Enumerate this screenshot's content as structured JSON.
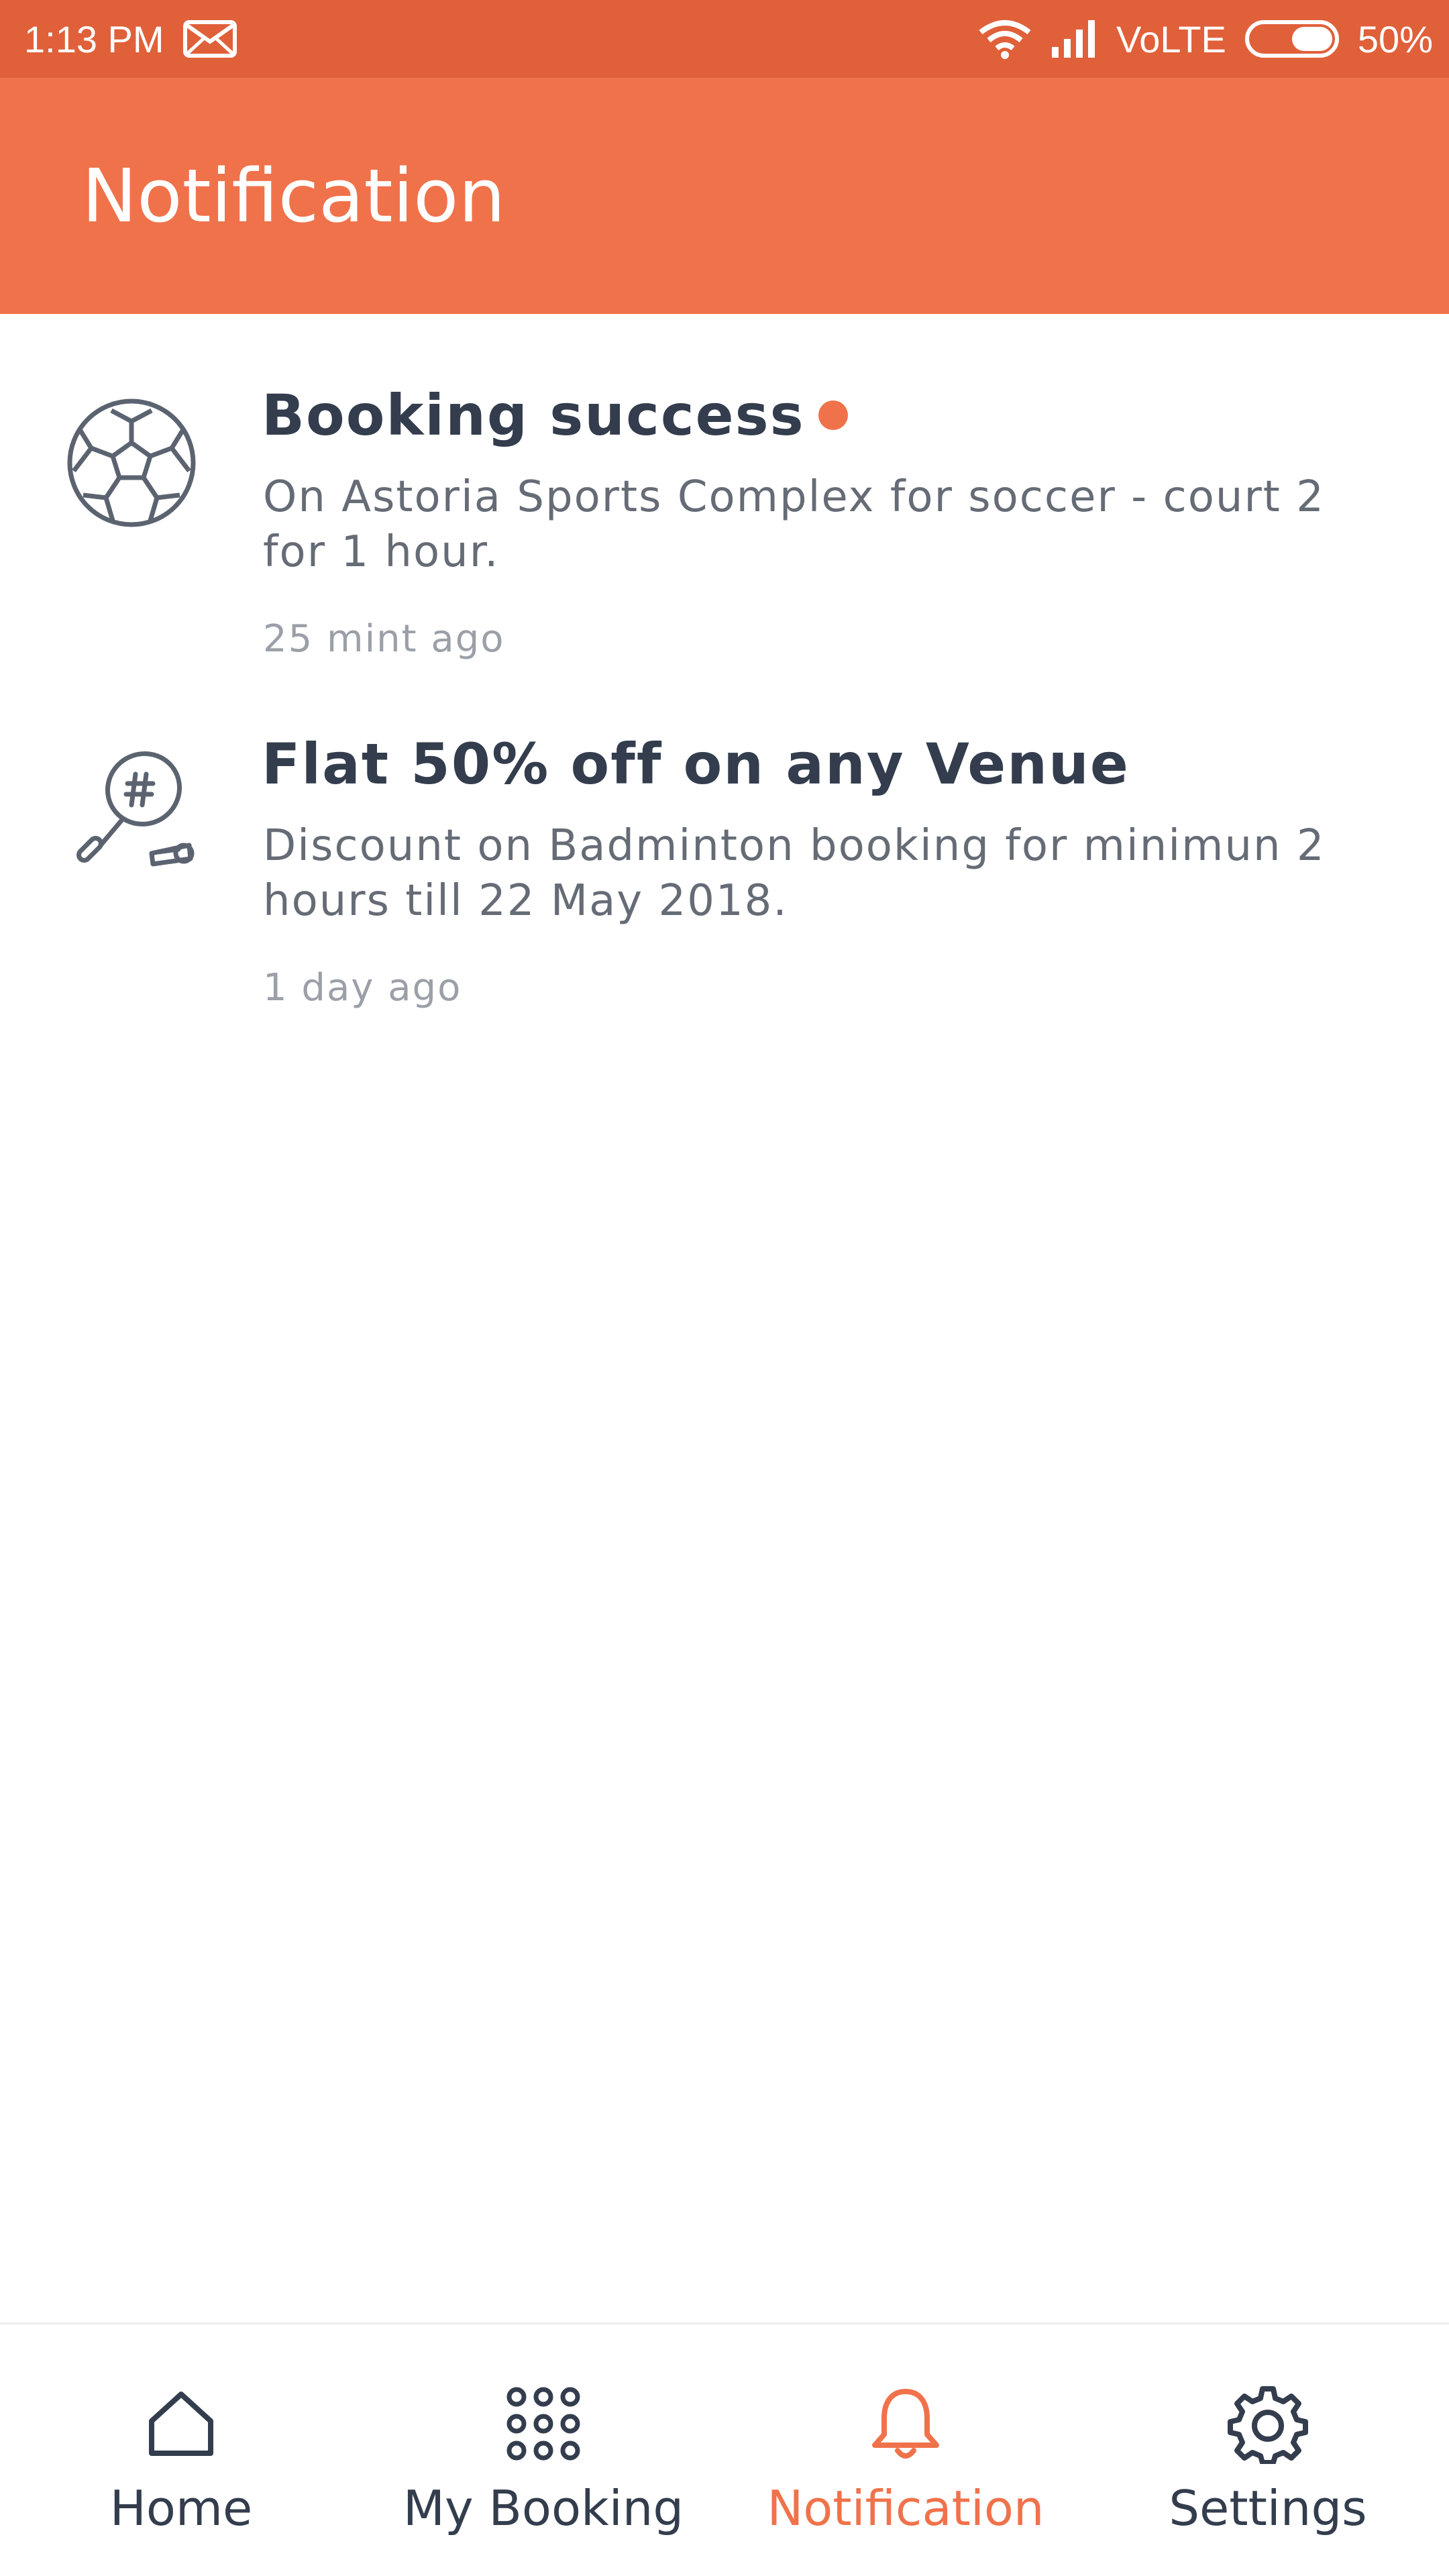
{
  "status_bar": {
    "time": "1:13 PM",
    "network": "VoLTE",
    "battery": "50%",
    "icons": [
      "mail-icon",
      "wifi-icon",
      "signal-icon",
      "battery-icon"
    ]
  },
  "app_bar": {
    "title": "Notification"
  },
  "notifications": [
    {
      "icon": "soccer-ball-icon",
      "title": "Booking success",
      "unread": true,
      "body": "On Astoria Sports Complex for soccer - court 2 for 1 hour.",
      "time": "25 mint ago"
    },
    {
      "icon": "badminton-icon",
      "title": "Flat 50% off on any Venue",
      "unread": false,
      "body": "Discount on Badminton booking for minimun 2 hours till 22 May 2018.",
      "time": "1 day ago"
    }
  ],
  "bottom_nav": {
    "items": [
      {
        "label": "Home",
        "icon": "home-icon",
        "active": false
      },
      {
        "label": "My Booking",
        "icon": "grid-icon",
        "active": false
      },
      {
        "label": "Notification",
        "icon": "bell-icon",
        "active": true
      },
      {
        "label": "Settings",
        "icon": "gear-icon",
        "active": false
      }
    ]
  },
  "colors": {
    "status_bar": "#E0603A",
    "app_bar": "#F0724B",
    "accent": "#F0724B",
    "text_primary": "#333D4D",
    "text_secondary": "#666C76",
    "text_muted": "#9BA0A8"
  }
}
